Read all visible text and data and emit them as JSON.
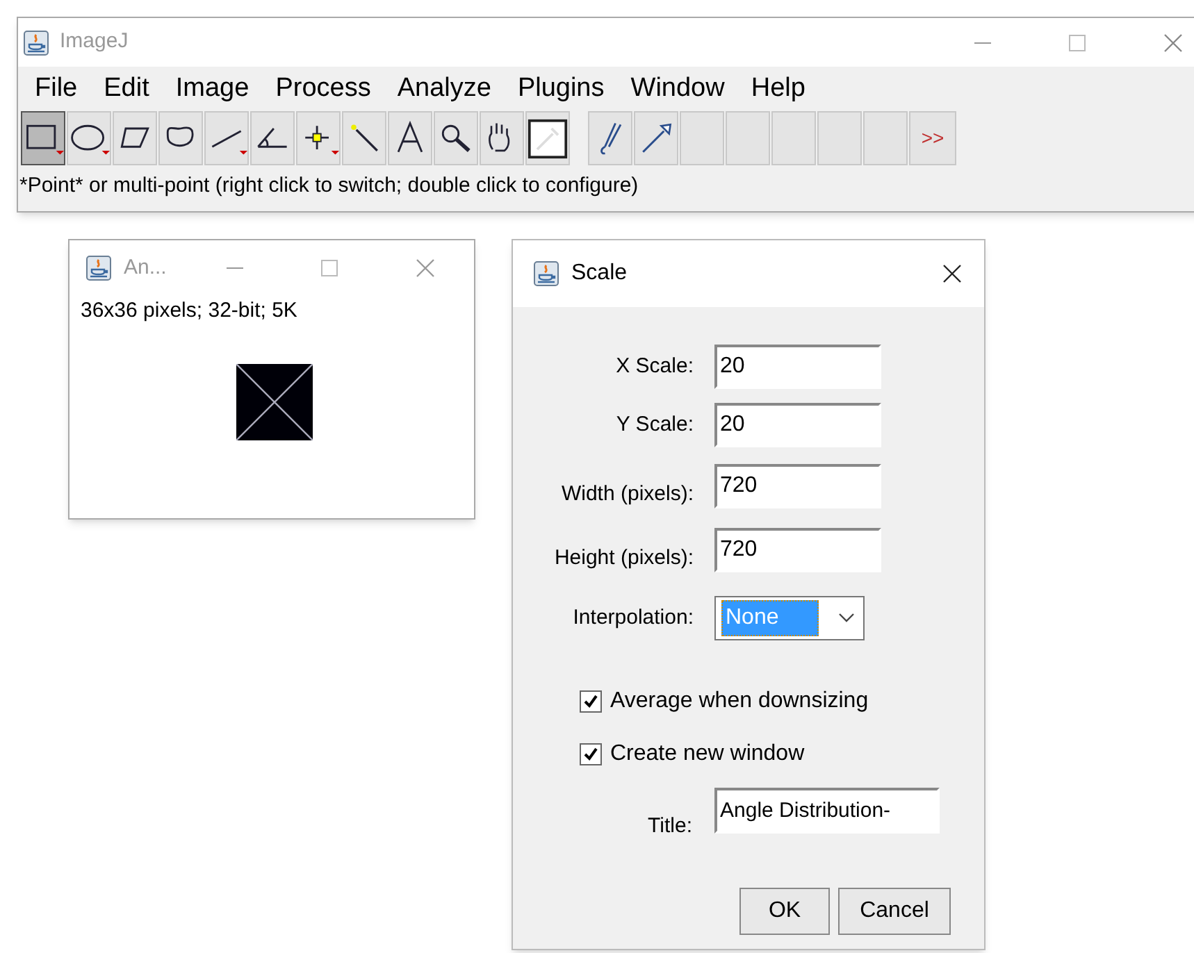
{
  "main_window": {
    "title": "ImageJ",
    "menu": [
      "File",
      "Edit",
      "Image",
      "Process",
      "Analyze",
      "Plugins",
      "Window",
      "Help"
    ],
    "tools": [
      {
        "kind": "rectangle",
        "selected": true
      },
      {
        "kind": "oval",
        "selected": false
      },
      {
        "kind": "polygon",
        "selected": false
      },
      {
        "kind": "freehand",
        "selected": false
      },
      {
        "kind": "line",
        "selected": false
      },
      {
        "kind": "angle",
        "selected": false
      },
      {
        "kind": "point",
        "selected": false
      },
      {
        "kind": "wand",
        "selected": false
      },
      {
        "kind": "text",
        "selected": false
      },
      {
        "kind": "magnifier",
        "selected": false
      },
      {
        "kind": "hand",
        "selected": false
      },
      {
        "kind": "dropper",
        "selected": false
      },
      {
        "kind": "brush",
        "selected": false
      },
      {
        "kind": "arrow",
        "selected": false
      },
      {
        "kind": "empty",
        "selected": false
      },
      {
        "kind": "empty",
        "selected": false
      },
      {
        "kind": "empty",
        "selected": false
      },
      {
        "kind": "empty",
        "selected": false
      },
      {
        "kind": "empty",
        "selected": false
      }
    ],
    "more_label": ">>",
    "status": "*Point* or multi-point (right click to switch; double click to configure)"
  },
  "image_window": {
    "title": "An...",
    "info": "36x36 pixels; 32-bit; 5K"
  },
  "scale_dialog": {
    "title": "Scale",
    "fields": [
      {
        "label": "X Scale:",
        "value": "20"
      },
      {
        "label": "Y Scale:",
        "value": "20"
      },
      {
        "label": "Width (pixels):",
        "value": "720"
      },
      {
        "label": "Height (pixels):",
        "value": "720"
      }
    ],
    "interpolation": {
      "label": "Interpolation:",
      "value": "None"
    },
    "checkboxes": [
      {
        "label": "Average when downsizing",
        "checked": true
      },
      {
        "label": "Create new window",
        "checked": true
      }
    ],
    "title_field": {
      "label": "Title:",
      "value": "Angle Distribution-"
    },
    "buttons": [
      "OK",
      "Cancel"
    ]
  }
}
